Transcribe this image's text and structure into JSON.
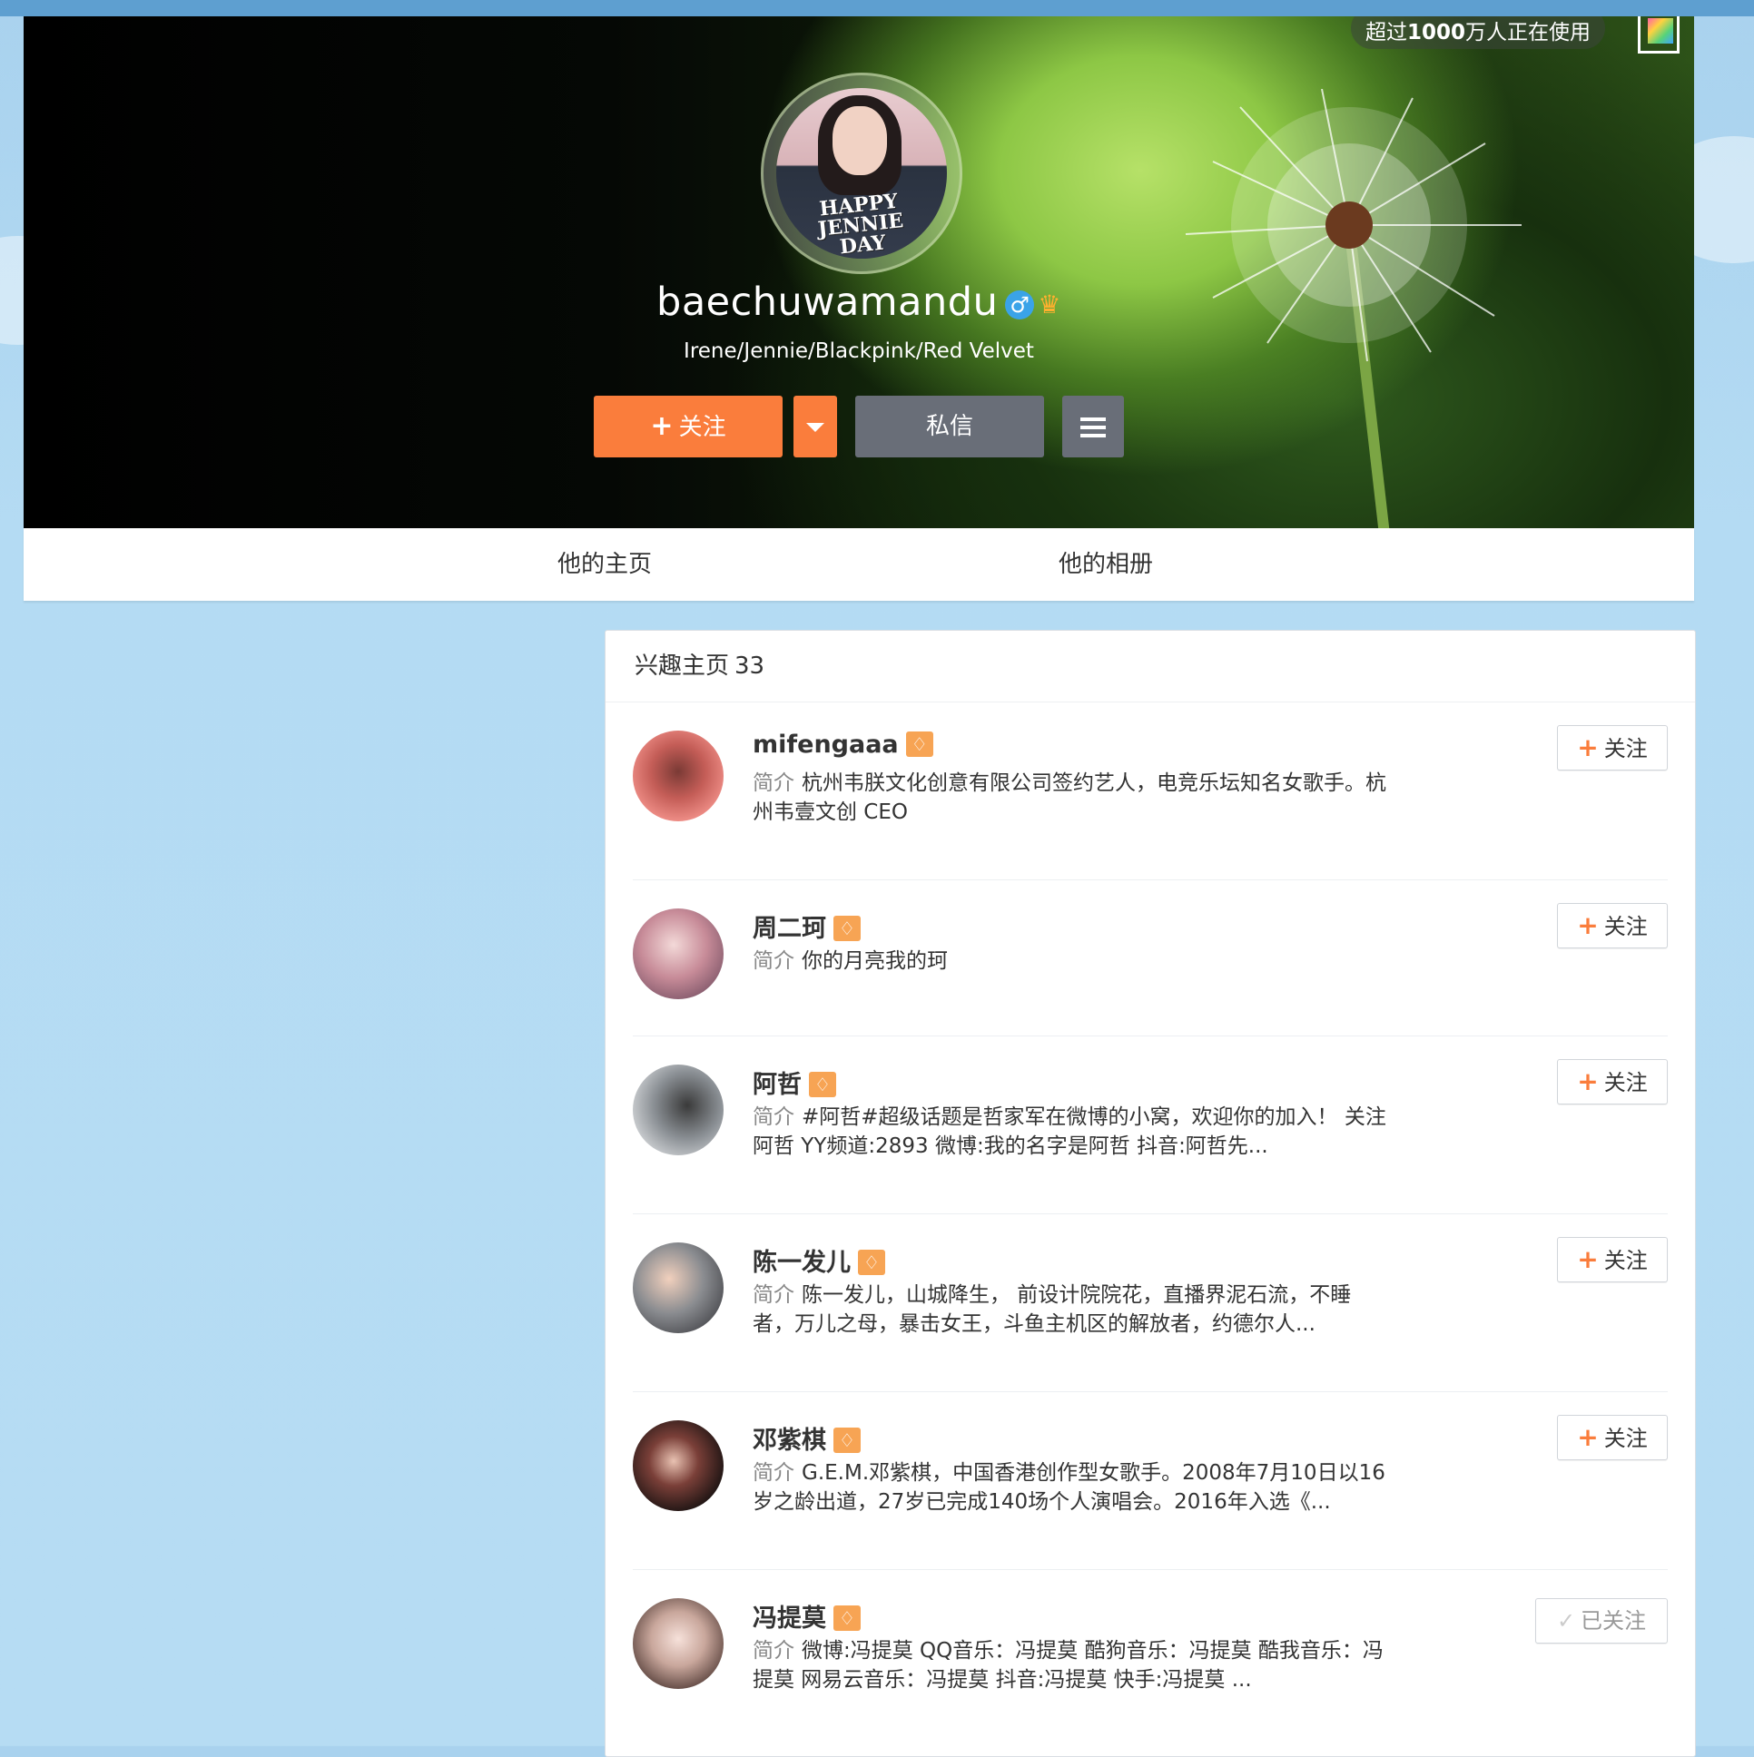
{
  "topbar": {
    "usage_prefix": "超过",
    "usage_number": "1000",
    "usage_suffix": "万人正在使用"
  },
  "profile": {
    "username": "baechuwamandu",
    "gender_symbol": "♂",
    "bio": "Irene/Jennie/Blackpink/Red Velvet",
    "avatar_text": [
      "HAPPY",
      "JENNIE",
      "DAY"
    ]
  },
  "actions": {
    "follow_label": "关注",
    "follow_plus": "+",
    "message_label": "私信"
  },
  "tabs": [
    {
      "label": "他的主页"
    },
    {
      "label": "他的相册"
    }
  ],
  "interest": {
    "title": "兴趣主页",
    "count": "33",
    "desc_label": "简介",
    "items": [
      {
        "name": "mifengaaa",
        "desc": "杭州韦朕文化创意有限公司签约艺人，电竞乐坛知名女歌手。杭州韦壹文创 CEO",
        "button": "关注",
        "followed": false,
        "avatar_color": "#e98a84"
      },
      {
        "name": "周二珂",
        "desc": "你的月亮我的珂",
        "button": "关注",
        "followed": false,
        "avatar_color": "#b97a8c"
      },
      {
        "name": "阿哲",
        "desc": "#阿哲#超级话题是哲家军在微博的小窝，欢迎你的加入！ 关注阿哲 YY频道:2893 微博:我的名字是阿哲 抖音:阿哲先...",
        "button": "关注",
        "followed": false,
        "avatar_color": "#9da2a6"
      },
      {
        "name": "陈一发儿",
        "desc": "陈一发儿，山城降生， 前设计院院花，直播界泥石流，不睡者，万儿之母，暴击女王，斗鱼主机区的解放者，约德尔人...",
        "button": "关注",
        "followed": false,
        "avatar_color": "#7b8a95"
      },
      {
        "name": "邓紫棋",
        "desc": "G.E.M.邓紫棋，中国香港创作型女歌手。2008年7月10日以16岁之龄出道，27岁已完成140场个人演唱会。2016年入选《...",
        "button": "关注",
        "followed": false,
        "avatar_color": "#3b2a26"
      },
      {
        "name": "冯提莫",
        "desc": "微博:冯提莫 QQ音乐：冯提莫 酷狗音乐：冯提莫 酷我音乐：冯提莫 网易云音乐：冯提莫 抖音:冯提莫 快手:冯提莫 ...",
        "button": "已关注",
        "followed": true,
        "avatar_color": "#c9b0a6"
      }
    ]
  }
}
